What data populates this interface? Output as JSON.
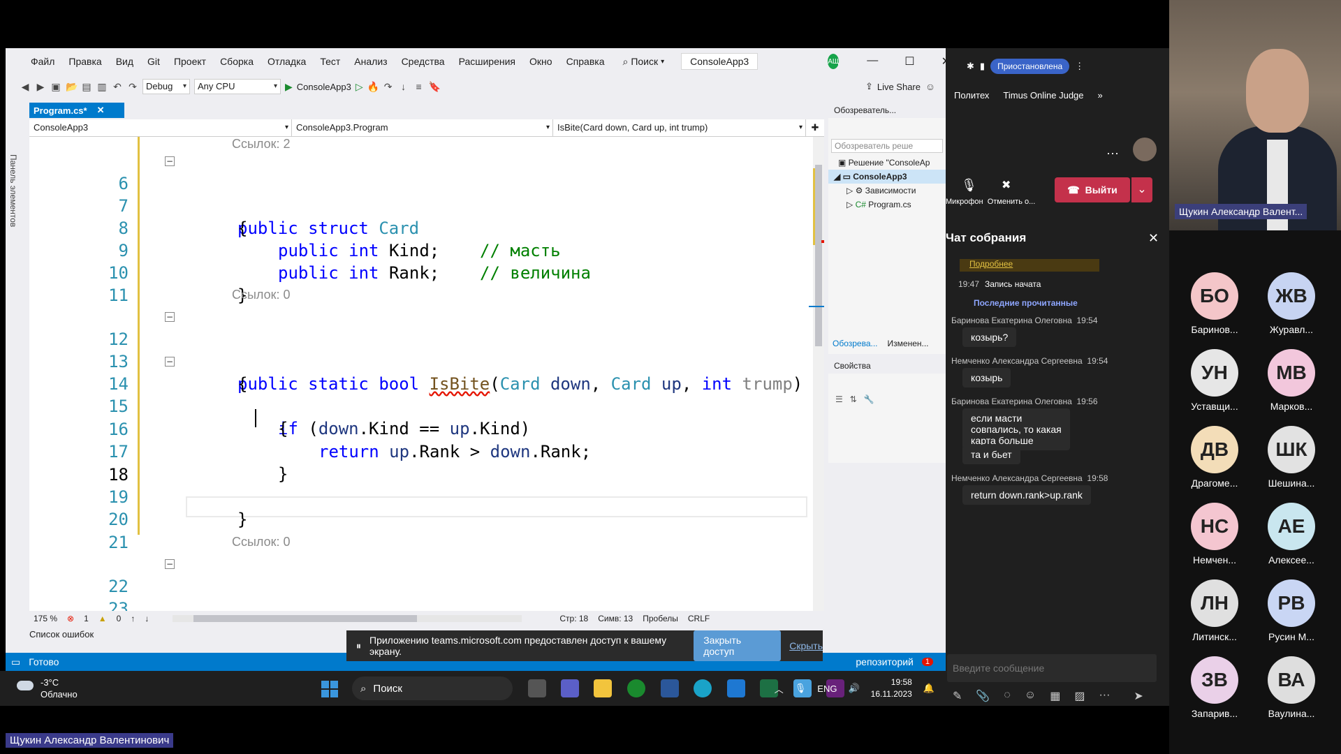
{
  "vs": {
    "menu": [
      "Файл",
      "Правка",
      "Вид",
      "Git",
      "Проект",
      "Сборка",
      "Отладка",
      "Тест",
      "Анализ",
      "Средства",
      "Расширения",
      "Окно",
      "Справка"
    ],
    "search_label": "Поиск",
    "solution_title": "ConsoleApp3",
    "user_initials": "АЩ",
    "toolbar": {
      "config": "Debug",
      "platform": "Any CPU",
      "run_target": "ConsoleApp3",
      "live_share": "Live Share"
    },
    "side_panel_label": "Панель элементов",
    "doc_tab": "Program.cs*",
    "nav": {
      "project": "ConsoleApp3",
      "class": "ConsoleApp3.Program",
      "member": "IsBite(Card down, Card up, int trump)"
    },
    "code": {
      "lens_top": "Ссылок: 2",
      "lens_isbite": "Ссылок: 0",
      "lens_main": "Ссылок: 0",
      "line_numbers": [
        "6",
        "7",
        "8",
        "9",
        "10",
        "11",
        "12",
        "13",
        "14",
        "15",
        "16",
        "17",
        "18",
        "19",
        "20",
        "21",
        "22",
        "23"
      ]
    },
    "status": {
      "zoom": "175 %",
      "errors": "1",
      "warnings": "0",
      "line": "Стр: 18",
      "col": "Симв: 13",
      "spaces": "Пробелы",
      "eol": "CRLF"
    },
    "error_list": "Список ошибок",
    "ready": "Готово",
    "repo": "репозиторий",
    "notif_count": "1",
    "solution_explorer": {
      "title": "Обозреватель...",
      "search_placeholder": "Обозреватель реше",
      "solution": "Решение \"ConsoleAp",
      "project": "ConsoleApp3",
      "deps": "Зависимости",
      "file": "Program.cs",
      "tab1": "Обозрева...",
      "tab2": "Изменен..."
    },
    "properties_title": "Свойства"
  },
  "share_banner": {
    "text": "Приложению teams.microsoft.com предоставлен доступ к вашему экрану.",
    "stop": "Закрыть доступ",
    "hide": "Скрыть"
  },
  "taskbar": {
    "temp": "-3°C",
    "weather": "Облачно",
    "search": "Поиск",
    "lang": "ENG",
    "time": "19:58",
    "date": "16.11.2023"
  },
  "presenter_label": "Щукин Александр Валентинович",
  "teams": {
    "status": "Приостановлена",
    "bookmarks": [
      "Политех",
      "Timus Online Judge"
    ],
    "mic": "Микрофон",
    "unshare": "Отменить о...",
    "leave": "Выйти",
    "chat_title": "Чат собрания",
    "more_link": "Подробнее",
    "rec_time": "19:47",
    "rec_text": "Запись начата",
    "last_read": "Последние прочитанные",
    "messages": [
      {
        "author": "Баринова Екатерина Олеговна",
        "time": "19:54",
        "text": "козырь?"
      },
      {
        "author": "Немченко Александра Сергеевна",
        "time": "19:54",
        "text": "козырь"
      },
      {
        "author": "Баринова Екатерина Олеговна",
        "time": "19:56",
        "text": "если масти совпались, то какая карта больше"
      },
      {
        "author": "",
        "time": "",
        "text": "та и бьет"
      },
      {
        "author": "Немченко Александра Сергеевна",
        "time": "19:58",
        "text": "return down.rank>up.rank"
      }
    ],
    "input_placeholder": "Введите сообщение"
  },
  "video_name": "Щукин Александр Валент...",
  "participants": [
    {
      "initials": "БО",
      "name": "Баринов...",
      "color": "#f4c6c9"
    },
    {
      "initials": "ЖВ",
      "name": "Журавл...",
      "color": "#c7d4f2"
    },
    {
      "initials": "УН",
      "name": "Уставщи...",
      "color": "#e6e6e6"
    },
    {
      "initials": "МВ",
      "name": "Марков...",
      "color": "#f2c7dc"
    },
    {
      "initials": "ДВ",
      "name": "Драгоме...",
      "color": "#f3ddb8"
    },
    {
      "initials": "ШК",
      "name": "Шешина...",
      "color": "#e2e2e2"
    },
    {
      "initials": "НС",
      "name": "Немчен...",
      "color": "#f4c6d0"
    },
    {
      "initials": "АЕ",
      "name": "Алексее...",
      "color": "#c9e6ef"
    },
    {
      "initials": "ЛН",
      "name": "Литинск...",
      "color": "#e0e0e0"
    },
    {
      "initials": "РВ",
      "name": "Русин М...",
      "color": "#c9d6f4"
    },
    {
      "initials": "ЗВ",
      "name": "Запарив...",
      "color": "#ead0e8"
    },
    {
      "initials": "ВА",
      "name": "Ваулина...",
      "color": "#dedede"
    }
  ]
}
